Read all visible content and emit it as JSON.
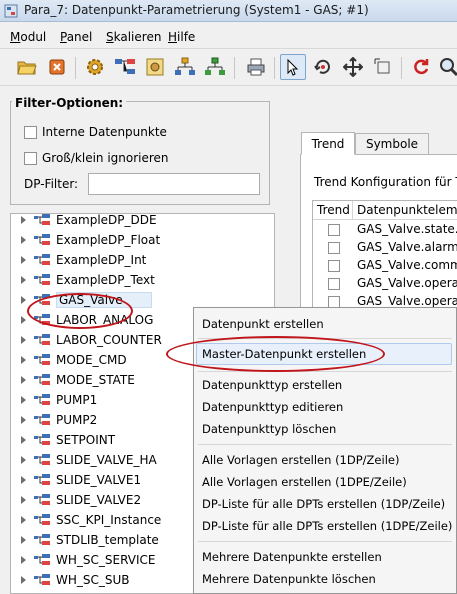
{
  "window": {
    "title": "Para_7: Datenpunkt-Parametrierung (System1 - GAS; #1)"
  },
  "menu": {
    "items": [
      {
        "label": "Modul",
        "mnemonic": "M",
        "rest": "odul"
      },
      {
        "label": "Panel",
        "mnemonic": "P",
        "rest": "anel"
      },
      {
        "label": "Skalieren",
        "mnemonic": "S",
        "rest": "kalieren"
      },
      {
        "label": "Hilfe",
        "mnemonic": "H",
        "rest": "ilfe"
      }
    ]
  },
  "toolbar": {
    "icons": [
      "open-folder-icon",
      "stop-icon",
      "gear-icon",
      "dp-structure-icon",
      "image-icon",
      "hierarchy-icon",
      "hierarchy-green-icon",
      "print-icon",
      "pointer-icon",
      "rotate-icon",
      "move-icon",
      "scale-icon",
      "refresh-icon",
      "search-icon"
    ]
  },
  "filter": {
    "title": "Filter-Optionen:",
    "internal_dp_label": "Interne Datenpunkte",
    "case_label": "Groß/klein ignorieren",
    "dp_filter_label": "DP-Filter:",
    "dp_filter_value": ""
  },
  "tree": {
    "items": [
      "ExampleDP_DDE",
      "ExampleDP_Float",
      "ExampleDP_Int",
      "ExampleDP_Text",
      "GAS_Valve",
      "LABOR_ANALOG",
      "LABOR_COUNTER",
      "MODE_CMD",
      "MODE_STATE",
      "PUMP1",
      "PUMP2",
      "SETPOINT",
      "SLIDE_VALVE_HA",
      "SLIDE_VALVE1",
      "SLIDE_VALVE2",
      "SSC_KPI_Instance",
      "STDLIB_template",
      "WH_SC_SERVICE",
      "WH_SC_SUB"
    ],
    "selected": "GAS_Valve"
  },
  "tabs": {
    "trend": "Trend",
    "symbole": "Symbole"
  },
  "trend": {
    "config_label": "Trend Konfiguration für Ty",
    "col_trend": "Trend",
    "col_dpe": "Datenpunkteleme",
    "rows": [
      "GAS_Valve.state.",
      "GAS_Valve.alarm",
      "GAS_Valve.comm",
      "GAS_Valve.opera",
      "GAS_Valve.opera"
    ]
  },
  "context_menu": {
    "items": [
      "Datenpunkt erstellen",
      "Master-Datenpunkt erstellen",
      "Datenpunkttyp erstellen",
      "Datenpunkttyp editieren",
      "Datenpunkttyp löschen",
      "Alle Vorlagen erstellen (1DP/Zeile)",
      "Alle Vorlagen erstellen (1DPE/Zeile)",
      "DP-Liste für alle DPTs erstellen (1DP/Zeile)",
      "DP-Liste für alle DPTs erstellen (1DPE/Zeile)",
      "Mehrere Datenpunkte erstellen",
      "Mehrere Datenpunkte löschen"
    ],
    "highlighted": "Master-Datenpunkt erstellen"
  },
  "annotation_color": "#c0161b"
}
